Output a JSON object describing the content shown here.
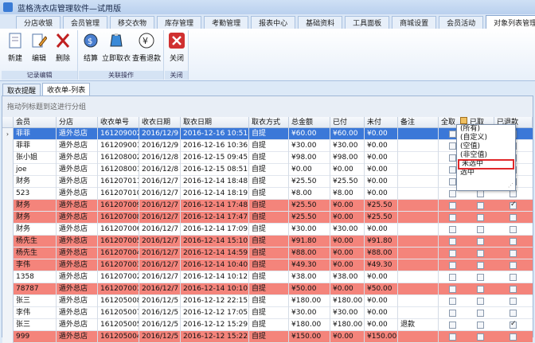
{
  "window": {
    "title": "蓝格洗衣店管理软件—试用版"
  },
  "menu_tabs": [
    "分店收银",
    "会员管理",
    "移交衣物",
    "库存管理",
    "考勤管理",
    "报表中心",
    "基础资料",
    "工具面板",
    "商城设置",
    "会员活动",
    "对象列表管理"
  ],
  "ribbon": {
    "groups": [
      {
        "label": "记录编辑",
        "buttons": [
          {
            "label": "新建",
            "icon": "new-doc-icon"
          },
          {
            "label": "编辑",
            "icon": "edit-icon"
          },
          {
            "label": "删除",
            "icon": "delete-icon"
          }
        ]
      },
      {
        "label": "关联操作",
        "buttons": [
          {
            "label": "结算",
            "icon": "settle-icon"
          },
          {
            "label": "立即取衣",
            "icon": "pickup-icon"
          },
          {
            "label": "查看退款",
            "icon": "refund-icon"
          }
        ]
      },
      {
        "label": "关闭",
        "buttons": [
          {
            "label": "关闭",
            "icon": "close-icon"
          }
        ]
      }
    ]
  },
  "sub_tabs": [
    "取衣提醒",
    "收衣单-列表"
  ],
  "group_bar": {
    "text": "拖动列标题到这进行分组"
  },
  "columns": [
    "会员",
    "分店",
    "收衣单号",
    "收衣日期",
    "取衣日期",
    "取衣方式",
    "总金额",
    "已付",
    "未付",
    "备注",
    "全取",
    "已取",
    "已退款"
  ],
  "rows": [
    {
      "color": "sel",
      "member": "菲菲",
      "store": "遁外总店",
      "no": "161209002",
      "date": "2016/12/9",
      "pick": "2016-12-16 10:51",
      "mode": "自提",
      "total": "¥60.00",
      "paid": "¥60.00",
      "unpaid": "¥0.00",
      "note": "",
      "all": false,
      "taken": false,
      "refund": false
    },
    {
      "color": "white",
      "member": "菲菲",
      "store": "遁外总店",
      "no": "161209001",
      "date": "2016/12/9",
      "pick": "2016-12-16 10:36",
      "mode": "自提",
      "total": "¥30.00",
      "paid": "¥30.00",
      "unpaid": "¥0.00",
      "note": "",
      "all": false,
      "taken": false,
      "refund": false
    },
    {
      "color": "white",
      "member": "张小姐",
      "store": "遁外总店",
      "no": "161208002",
      "date": "2016/12/8",
      "pick": "2016-12-15 09:45",
      "mode": "自提",
      "total": "¥98.00",
      "paid": "¥98.00",
      "unpaid": "¥0.00",
      "note": "",
      "all": false,
      "taken": false,
      "refund": false
    },
    {
      "color": "white",
      "member": "joe",
      "store": "遁外总店",
      "no": "161208001",
      "date": "2016/12/8",
      "pick": "2016-12-15 08:51",
      "mode": "自提",
      "total": "¥0.00",
      "paid": "¥0.00",
      "unpaid": "¥0.00",
      "note": "",
      "all": false,
      "taken": false,
      "refund": false
    },
    {
      "color": "white",
      "member": "财务",
      "store": "遁外总店",
      "no": "161207011",
      "date": "2016/12/7",
      "pick": "2016-12-14 18:48",
      "mode": "自提",
      "total": "¥25.50",
      "paid": "¥25.50",
      "unpaid": "¥0.00",
      "note": "",
      "all": false,
      "taken": false,
      "refund": false
    },
    {
      "color": "white",
      "member": "523",
      "store": "遁外总店",
      "no": "161207010",
      "date": "2016/12/7",
      "pick": "2016-12-14 18:19",
      "mode": "自提",
      "total": "¥8.00",
      "paid": "¥8.00",
      "unpaid": "¥0.00",
      "note": "",
      "all": false,
      "taken": false,
      "refund": false
    },
    {
      "color": "red",
      "member": "财务",
      "store": "遁外总店",
      "no": "161207009",
      "date": "2016/12/7",
      "pick": "2016-12-14 17:48",
      "mode": "自提",
      "total": "¥25.50",
      "paid": "¥0.00",
      "unpaid": "¥25.50",
      "note": "",
      "all": false,
      "taken": false,
      "refund": true
    },
    {
      "color": "red",
      "member": "财务",
      "store": "遁外总店",
      "no": "161207008",
      "date": "2016/12/7",
      "pick": "2016-12-14 17:47",
      "mode": "自提",
      "total": "¥25.50",
      "paid": "¥0.00",
      "unpaid": "¥25.50",
      "note": "",
      "all": false,
      "taken": false,
      "refund": false
    },
    {
      "color": "white",
      "member": "财务",
      "store": "遁外总店",
      "no": "161207006",
      "date": "2016/12/7",
      "pick": "2016-12-14 17:09",
      "mode": "自提",
      "total": "¥30.00",
      "paid": "¥30.00",
      "unpaid": "¥0.00",
      "note": "",
      "all": false,
      "taken": false,
      "refund": false
    },
    {
      "color": "red",
      "member": "杨先生",
      "store": "遁外总店",
      "no": "161207005",
      "date": "2016/12/7",
      "pick": "2016-12-14 15:10",
      "mode": "自提",
      "total": "¥91.80",
      "paid": "¥0.00",
      "unpaid": "¥91.80",
      "note": "",
      "all": false,
      "taken": false,
      "refund": false
    },
    {
      "color": "red",
      "member": "杨先生",
      "store": "遁外总店",
      "no": "161207004",
      "date": "2016/12/7",
      "pick": "2016-12-14 14:59",
      "mode": "自提",
      "total": "¥88.00",
      "paid": "¥0.00",
      "unpaid": "¥88.00",
      "note": "",
      "all": false,
      "taken": false,
      "refund": false
    },
    {
      "color": "red",
      "member": "李伟",
      "store": "遁外总店",
      "no": "161207003",
      "date": "2016/12/7",
      "pick": "2016-12-14 10:40",
      "mode": "自提",
      "total": "¥49.30",
      "paid": "¥0.00",
      "unpaid": "¥49.30",
      "note": "",
      "all": false,
      "taken": false,
      "refund": false
    },
    {
      "color": "white",
      "member": "1358",
      "store": "遁外总店",
      "no": "161207002",
      "date": "2016/12/7",
      "pick": "2016-12-14 10:12",
      "mode": "自提",
      "total": "¥38.00",
      "paid": "¥38.00",
      "unpaid": "¥0.00",
      "note": "",
      "all": false,
      "taken": false,
      "refund": false
    },
    {
      "color": "red",
      "member": "78787",
      "store": "遁外总店",
      "no": "161207001",
      "date": "2016/12/7",
      "pick": "2016-12-14 10:10",
      "mode": "自提",
      "total": "¥50.00",
      "paid": "¥0.00",
      "unpaid": "¥50.00",
      "note": "",
      "all": false,
      "taken": false,
      "refund": false
    },
    {
      "color": "white",
      "member": "张三",
      "store": "遁外总店",
      "no": "161205008",
      "date": "2016/12/5",
      "pick": "2016-12-12 22:15",
      "mode": "自提",
      "total": "¥180.00",
      "paid": "¥180.00",
      "unpaid": "¥0.00",
      "note": "",
      "all": false,
      "taken": false,
      "refund": false
    },
    {
      "color": "white",
      "member": "李伟",
      "store": "遁外总店",
      "no": "161205007",
      "date": "2016/12/5",
      "pick": "2016-12-12 17:05",
      "mode": "自提",
      "total": "¥30.00",
      "paid": "¥30.00",
      "unpaid": "¥0.00",
      "note": "",
      "all": false,
      "taken": false,
      "refund": false
    },
    {
      "color": "white",
      "member": "张三",
      "store": "遁外总店",
      "no": "161205005",
      "date": "2016/12/5",
      "pick": "2016-12-12 15:29",
      "mode": "自提",
      "total": "¥180.00",
      "paid": "¥180.00",
      "unpaid": "¥0.00",
      "note": "退款",
      "all": false,
      "taken": false,
      "refund": true
    },
    {
      "color": "red",
      "member": "999",
      "store": "遁外总店",
      "no": "161205004",
      "date": "2016/12/5",
      "pick": "2016-12-12 15:22",
      "mode": "自提",
      "total": "¥150.00",
      "paid": "¥0.00",
      "unpaid": "¥150.00",
      "note": "",
      "all": false,
      "taken": false,
      "refund": false
    }
  ],
  "filter_dropdown": {
    "items": [
      "(所有)",
      "(自定义)",
      "(空值)",
      "(非空值)",
      "未选中",
      "选中"
    ],
    "highlighted": "未选中"
  }
}
